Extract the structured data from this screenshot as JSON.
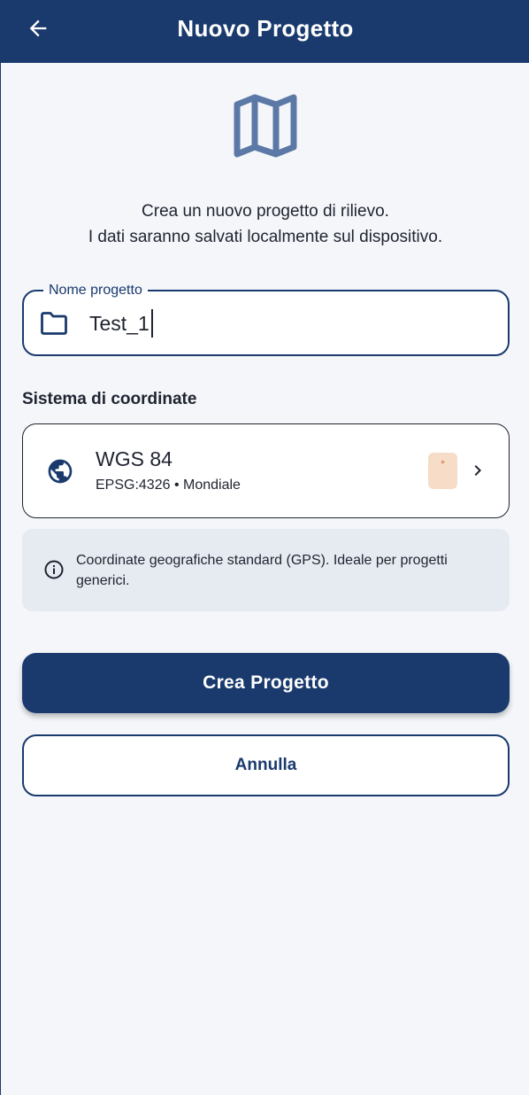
{
  "app_bar": {
    "title": "Nuovo Progetto",
    "back_icon": "arrow-left-icon",
    "background": "#1a3a6e"
  },
  "hero": {
    "icon": "map-icon",
    "line1": "Crea un nuovo progetto di rilievo.",
    "line2": "I dati saranno salvati localmente sul dispositivo."
  },
  "project_name_field": {
    "label": "Nome progetto",
    "value": "Test_1",
    "icon": "folder-icon"
  },
  "coordinate_system": {
    "section_label": "Sistema di coordinate",
    "name": "WGS 84",
    "subtitle": "EPSG:4326 • Mondiale",
    "unit_badge": "°",
    "icon": "globe-icon"
  },
  "info": {
    "icon": "info-icon",
    "text": "Coordinate geografiche standard (GPS). Ideale per progetti generici."
  },
  "actions": {
    "create_label": "Crea Progetto",
    "cancel_label": "Annulla"
  },
  "colors": {
    "primary": "#1a3a6e",
    "background": "#f4f6fa",
    "info_background": "#e6eaf1",
    "badge_background": "#f7dcc8"
  }
}
